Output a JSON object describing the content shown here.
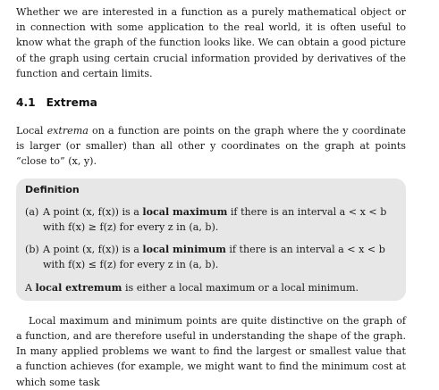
{
  "intro": "Whether we are interested in a function as a purely mathematical object or in connection with some application to the real world, it is often useful to know what the graph of the function looks like. We can obtain a good picture of the graph using certain crucial information provided by derivatives of the function and certain limits.",
  "section": {
    "number": "4.1",
    "title": "Extrema"
  },
  "para1": {
    "pre": "Local ",
    "term": "extrema",
    "post": " on a function are points on the graph where the y coordinate is larger (or smaller) than all other y coordinates on the graph at points “close to” (x, y)."
  },
  "definition": {
    "heading": "Definition",
    "items": [
      {
        "label": "(a)",
        "pre": "A point (x, f(x)) is a ",
        "term": "local maximum",
        "post": " if there is an interval a < x < b with f(x) ≥ f(z) for every z in (a, b)."
      },
      {
        "label": "(b)",
        "pre": "A point (x, f(x)) is a ",
        "term": "local minimum",
        "post": " if there is an interval a < x < b with f(x) ≤ f(z) for every z in (a, b)."
      }
    ],
    "foot": {
      "pre": "A ",
      "term": "local extremum",
      "post": " is either a local maximum or a local minimum."
    }
  },
  "para2": "Local maximum and minimum points are quite distinctive on the graph of a function, and are therefore useful in understanding the shape of the graph. In many applied problems we want to find the largest or smallest value that a function achieves (for example, we might want to find the minimum cost at which some task"
}
